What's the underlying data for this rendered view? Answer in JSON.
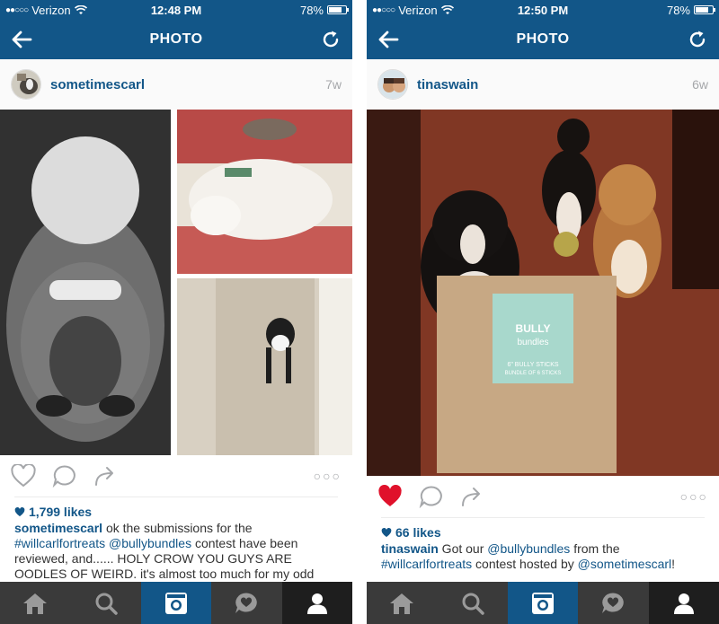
{
  "colors": {
    "brand": "#125688",
    "heart_liked": "#e0112b",
    "muted": "#a5a7aa"
  },
  "screens": [
    {
      "status": {
        "carrier": "Verizon",
        "time": "12:48 PM",
        "battery": "78%",
        "battery_level": 0.78
      },
      "nav": {
        "title": "PHOTO",
        "back_icon": "arrow-left-icon",
        "refresh_icon": "refresh-icon"
      },
      "post": {
        "username": "sometimescarl",
        "ago": "7w",
        "liked": false,
        "likes": "1,799 likes",
        "caption_user": "sometimescarl",
        "caption_part1": " ok the submissions for the ",
        "caption_tag1": "#willcarlfortreats",
        "caption_part2": " ",
        "caption_tag2": "@bullybundles",
        "caption_part3": " contest have been reviewed, and...... HOLY CROW YOU GUYS ARE OODLES OF WEIRD. it's almost too much for my odd"
      }
    },
    {
      "status": {
        "carrier": "Verizon",
        "time": "12:50 PM",
        "battery": "78%",
        "battery_level": 0.78
      },
      "nav": {
        "title": "PHOTO",
        "back_icon": "arrow-left-icon",
        "refresh_icon": "refresh-icon"
      },
      "post": {
        "username": "tinaswain",
        "ago": "6w",
        "liked": true,
        "likes": "66 likes",
        "caption_user": "tinaswain",
        "caption_part1": " Got our ",
        "caption_tag1": "@bullybundles",
        "caption_part2": " from the ",
        "caption_tag2": "#willcarlfortreats",
        "caption_part3": " contest hosted by ",
        "caption_tag3": "@sometimescarl",
        "caption_part4": "!",
        "bag_brand_line1": "BULLY",
        "bag_brand_line2": "bundles",
        "bag_sub_line1": "6\" BULLY STICKS",
        "bag_sub_line2": "BUNDLE OF 6 STICKS"
      }
    }
  ],
  "tabs": [
    "home-icon",
    "search-icon",
    "camera-icon",
    "activity-icon",
    "profile-icon"
  ]
}
